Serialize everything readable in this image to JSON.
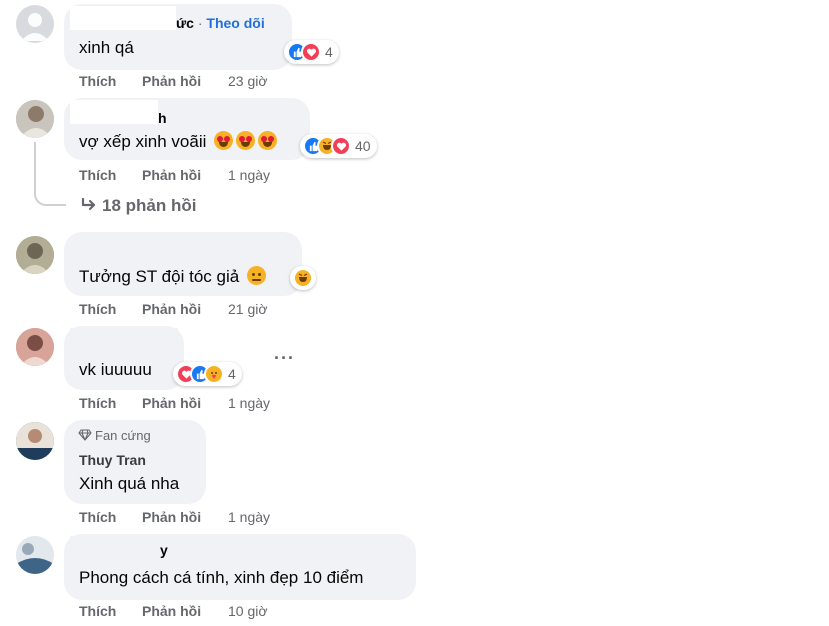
{
  "action_labels": {
    "like": "Thích",
    "reply": "Phản hồi"
  },
  "colors": {
    "link": "#216fdb",
    "muted": "#65676b",
    "bubble": "#f0f2f5",
    "like": "#1877f2",
    "love": "#f33e58",
    "haha": "#f7b125"
  },
  "comments": [
    {
      "name_suffix": "ức",
      "separator": " · ",
      "follow_label": "Theo dõi",
      "text": "xinh qá",
      "time": "23 giờ",
      "reactions": {
        "icons": [
          "like-icon",
          "love-icon"
        ],
        "count": "4"
      }
    },
    {
      "name_suffix": "h",
      "text": "vợ xếp xinh voãii",
      "emojis": [
        "heart-eyes-emoji",
        "heart-eyes-emoji",
        "heart-eyes-emoji"
      ],
      "time": "1 ngày",
      "reactions": {
        "icons": [
          "like-icon",
          "haha-icon",
          "love-icon"
        ],
        "count": "40"
      },
      "replies_label": "18 phản hồi"
    },
    {
      "text": "Tưởng ST đội tóc giả",
      "emojis": [
        "sad-face-emoji"
      ],
      "time": "21 giờ",
      "reactions": {
        "icons": [
          "haha-icon"
        ],
        "count": ""
      }
    },
    {
      "text": "vk iuuuuu",
      "time": "1 ngày",
      "reactions": {
        "icons": [
          "love-icon",
          "like-icon",
          "care-icon"
        ],
        "count": "4"
      }
    },
    {
      "badge": "Fan cứng",
      "name": "Thuy Tran",
      "text": "Xinh quá nha",
      "time": "1 ngày"
    },
    {
      "name_suffix": "y",
      "text": "Phong cách cá tính, xinh đẹp 10 điểm",
      "time": "10 giờ"
    }
  ]
}
